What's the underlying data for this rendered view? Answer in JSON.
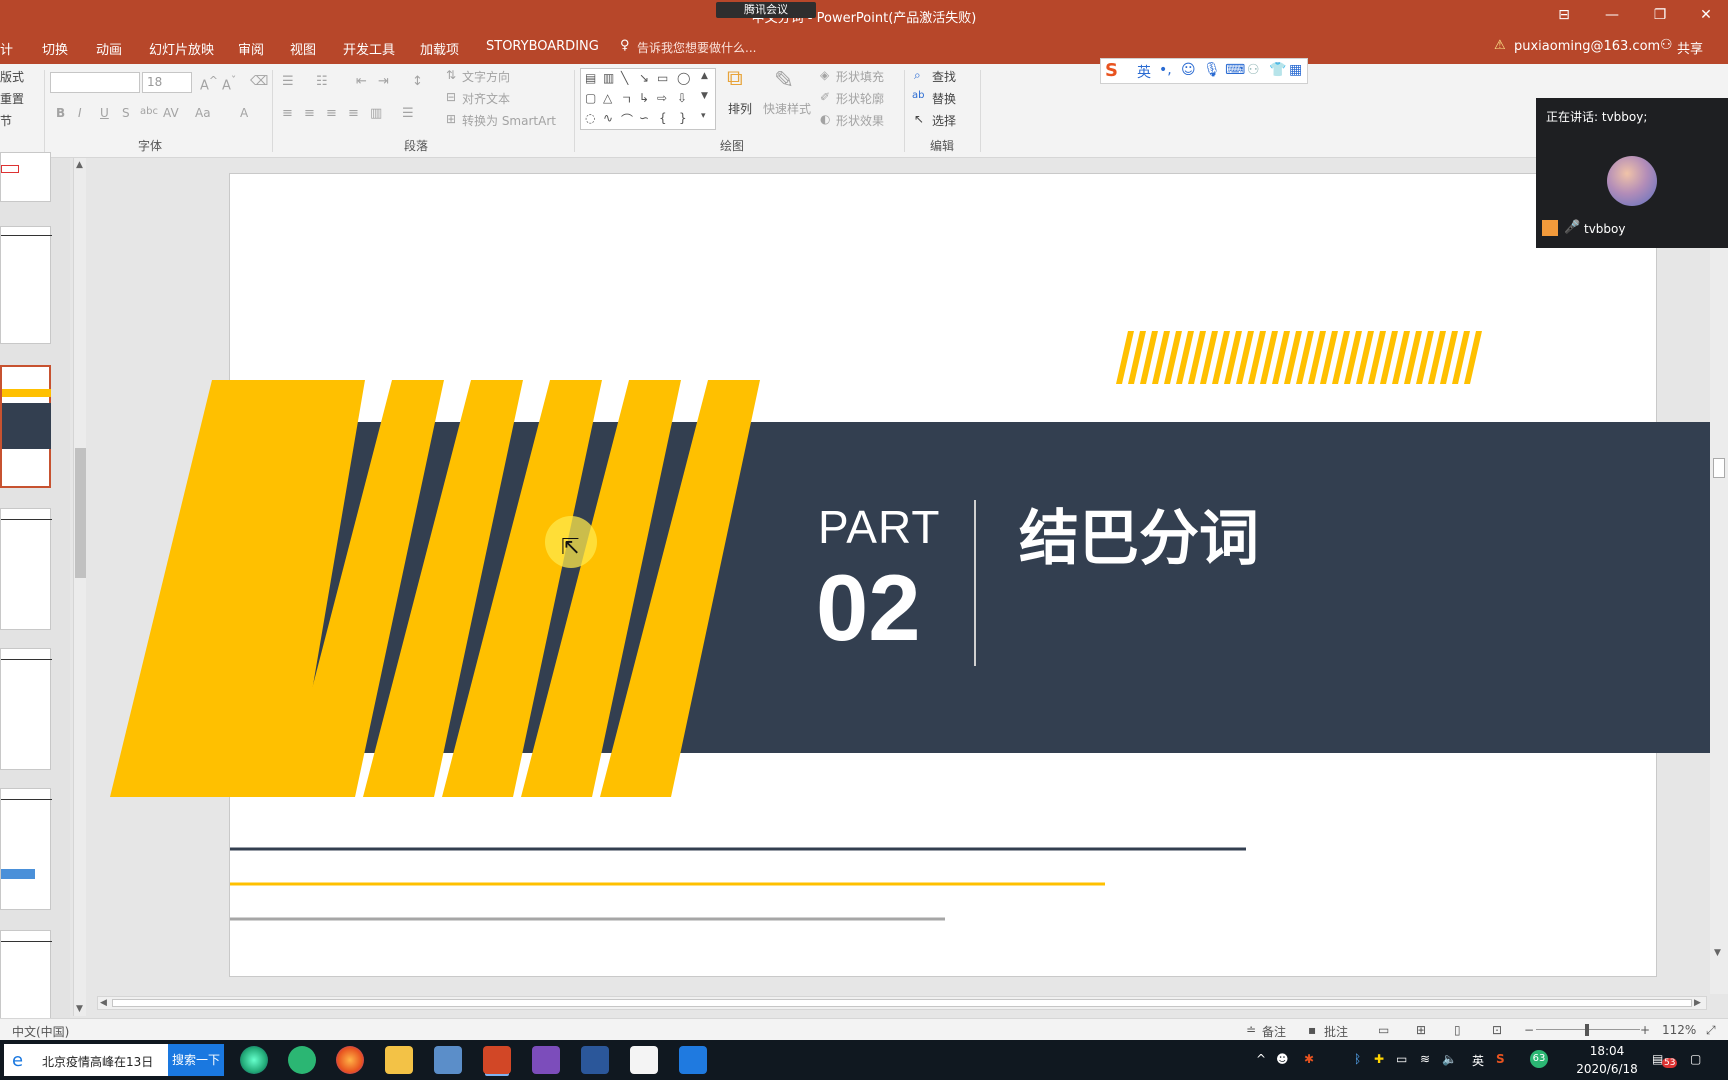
{
  "titlebar": {
    "title": "中文分词 - PowerPoint(产品激活失败)",
    "meeting_badge": "腾讯会议",
    "controls": [
      "⊟",
      "—",
      "❐",
      "✕"
    ]
  },
  "menubar": {
    "items": [
      "计",
      "切换",
      "动画",
      "幻灯片放映",
      "审阅",
      "视图",
      "开发工具",
      "加载项",
      "STORYBOARDING"
    ],
    "tell_me": "告诉我您想要做什么...",
    "account": "puxiaoming@163.com",
    "share": "共享"
  },
  "ribbon": {
    "slides_group": [
      "版式",
      "重置",
      "节"
    ],
    "font_size": "18",
    "font_group_label": "字体",
    "paragraph_group_label": "段落",
    "text_direction": "文字方向",
    "align_text": "对齐文本",
    "convert_smartart": "转换为 SmartArt",
    "arrange": "排列",
    "quick_styles": "快速样式",
    "shape_fill": "形状填充",
    "shape_outline": "形状轮廓",
    "shape_effects": "形状效果",
    "drawing_group_label": "绘图",
    "find": "查找",
    "replace": "替换",
    "select": "选择",
    "editing_group_label": "编辑",
    "format_buttons": [
      "B",
      "I",
      "U",
      "S",
      "abc",
      "AV",
      "Aa",
      "A"
    ]
  },
  "ime_toolbar": {
    "logo": "S",
    "mode": "英"
  },
  "slide": {
    "part_label": "PART",
    "part_number": "02",
    "heading": "结巴分词",
    "colors": {
      "yellow": "#ffc000",
      "navy": "#333f50",
      "gray_line": "#a6a6a6"
    }
  },
  "meeting_panel": {
    "speaking_label": "正在讲话: tvbboy;",
    "participant": "tvbboy"
  },
  "statusbar": {
    "language": "中文(中国)",
    "notes": "备注",
    "comments": "批注",
    "zoom": "112%"
  },
  "taskbar": {
    "search_text": "北京疫情高峰在13日",
    "search_button": "搜索一下",
    "tray_lang": "英",
    "time": "18:04",
    "date": "2020/6/18",
    "notification_count": "53",
    "battery_badge": "63"
  }
}
